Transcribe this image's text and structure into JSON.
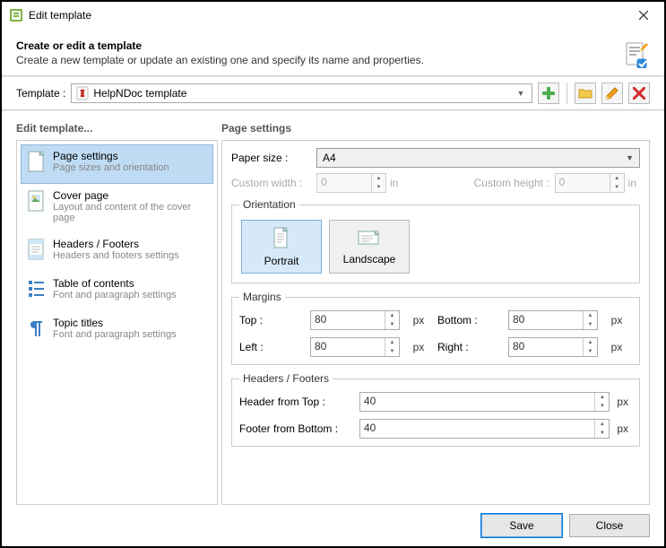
{
  "window": {
    "title": "Edit template"
  },
  "header": {
    "title": "Create or edit a template",
    "subtitle": "Create a new template or update an existing one and specify its name and properties."
  },
  "templateRow": {
    "label": "Template :",
    "selected": "HelpNDoc template"
  },
  "sidebar": {
    "title": "Edit template...",
    "items": [
      {
        "label": "Page settings",
        "desc": "Page sizes and orientation"
      },
      {
        "label": "Cover page",
        "desc": "Layout and content of the cover page"
      },
      {
        "label": "Headers / Footers",
        "desc": "Headers and footers settings"
      },
      {
        "label": "Table of contents",
        "desc": "Font and paragraph settings"
      },
      {
        "label": "Topic titles",
        "desc": "Font and paragraph settings"
      }
    ]
  },
  "main": {
    "title": "Page settings",
    "paperSizeLabel": "Paper size :",
    "paperSize": "A4",
    "customWidthLabel": "Custom width :",
    "customWidthValue": "0",
    "customWidthUnit": "in",
    "customHeightLabel": "Custom height :",
    "customHeightValue": "0",
    "customHeightUnit": "in",
    "orientation": {
      "legend": "Orientation",
      "portrait": "Portrait",
      "landscape": "Landscape"
    },
    "margins": {
      "legend": "Margins",
      "topLabel": "Top :",
      "topValue": "80",
      "bottomLabel": "Bottom :",
      "bottomValue": "80",
      "leftLabel": "Left :",
      "leftValue": "80",
      "rightLabel": "Right :",
      "rightValue": "80",
      "unit": "px"
    },
    "hf": {
      "legend": "Headers / Footers",
      "headerLabel": "Header from Top :",
      "headerValue": "40",
      "footerLabel": "Footer from Bottom :",
      "footerValue": "40",
      "unit": "px"
    }
  },
  "footer": {
    "save": "Save",
    "close": "Close"
  }
}
